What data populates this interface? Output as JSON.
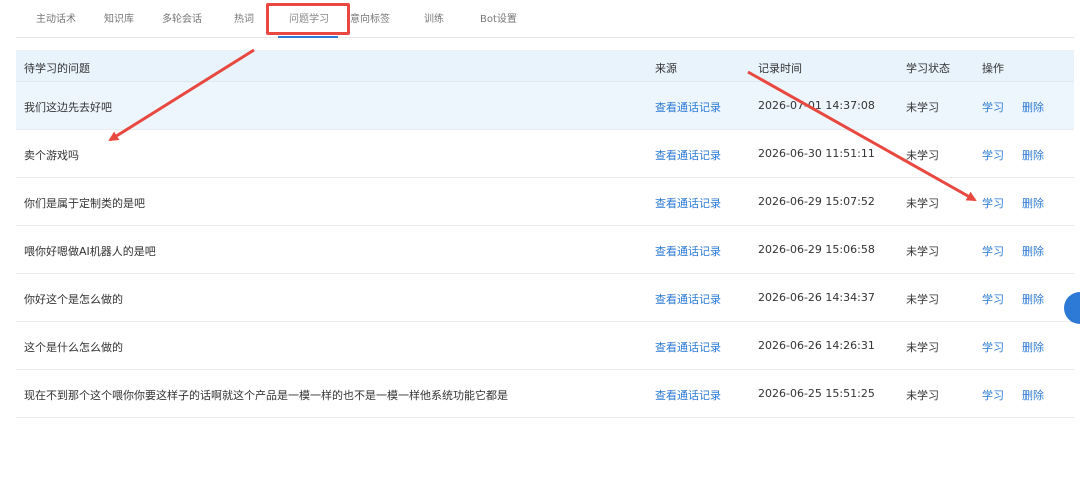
{
  "tabs": [
    {
      "label": "主动话术"
    },
    {
      "label": "知识库"
    },
    {
      "label": "多轮会话"
    },
    {
      "label": "热词"
    },
    {
      "label": "问题学习"
    },
    {
      "label": "意向标签"
    },
    {
      "label": "训练"
    },
    {
      "label": "Bot设置"
    }
  ],
  "active_tab": "问题学习",
  "table": {
    "headers": {
      "question": "待学习的问题",
      "source": "来源",
      "time": "记录时间",
      "status": "学习状态",
      "actions": "操作"
    },
    "rows": [
      {
        "question": "我们这边先去好吧",
        "source": "查看通话记录",
        "time": "2026-07-01 14:37:08",
        "status": "未学习",
        "learn": "学习",
        "delete": "删除"
      },
      {
        "question": "卖个游戏吗",
        "source": "查看通话记录",
        "time": "2026-06-30 11:51:11",
        "status": "未学习",
        "learn": "学习",
        "delete": "删除"
      },
      {
        "question": "你们是属于定制类的是吧",
        "source": "查看通话记录",
        "time": "2026-06-29 15:07:52",
        "status": "未学习",
        "learn": "学习",
        "delete": "删除"
      },
      {
        "question": "喂你好嗯做AI机器人的是吧",
        "source": "查看通话记录",
        "time": "2026-06-29 15:06:58",
        "status": "未学习",
        "learn": "学习",
        "delete": "删除"
      },
      {
        "question": "你好这个是怎么做的",
        "source": "查看通话记录",
        "time": "2026-06-26 14:34:37",
        "status": "未学习",
        "learn": "学习",
        "delete": "删除"
      },
      {
        "question": "这个是什么怎么做的",
        "source": "查看通话记录",
        "time": "2026-06-26 14:26:31",
        "status": "未学习",
        "learn": "学习",
        "delete": "删除"
      },
      {
        "question": "现在不到那个这个喂你你要这样子的话啊就这个产品是一模一样的也不是一模一样他系统功能它都是",
        "source": "查看通话记录",
        "time": "2026-06-25 15:51:25",
        "status": "未学习",
        "learn": "学习",
        "delete": "删除"
      }
    ]
  },
  "colors": {
    "accent": "#2d7ad6",
    "annotation": "#e8483f",
    "header_bg": "#e8f3fc"
  }
}
